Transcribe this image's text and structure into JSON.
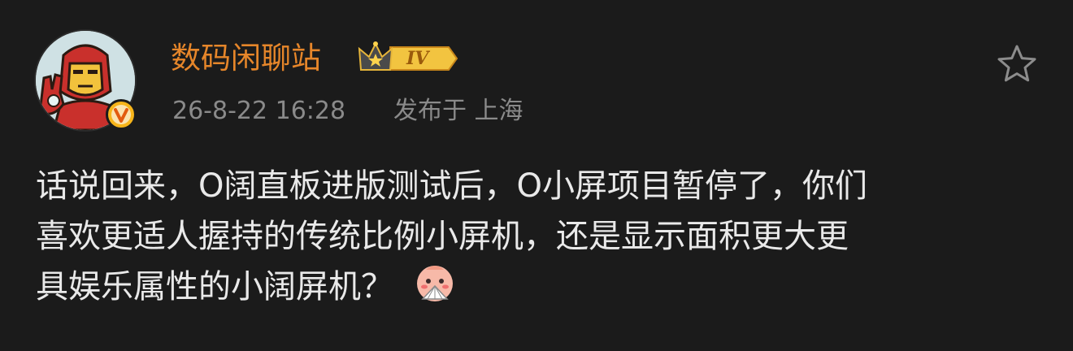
{
  "post": {
    "author": {
      "name": "数码闲聊站",
      "level": "IV",
      "avatar_icon": "ironman-avatar-icon",
      "verified_icon": "verified-v-icon",
      "name_color": "#e6862a",
      "badge_color": "#f7b51a"
    },
    "meta": {
      "timestamp": "26-8-22 16:28",
      "location": "发布于 上海"
    },
    "actions": {
      "favorite_icon": "star-outline-icon"
    },
    "content": {
      "lines": [
        "话说回来，O阔直板进版测试后，O小屏项目暂停了，你们",
        "喜欢更适人握持的传统比例小屏机，还是显示面积更大更",
        "具娱乐属性的小阔屏机？"
      ],
      "emoji_icon": "shy-fan-emoji-icon"
    }
  }
}
